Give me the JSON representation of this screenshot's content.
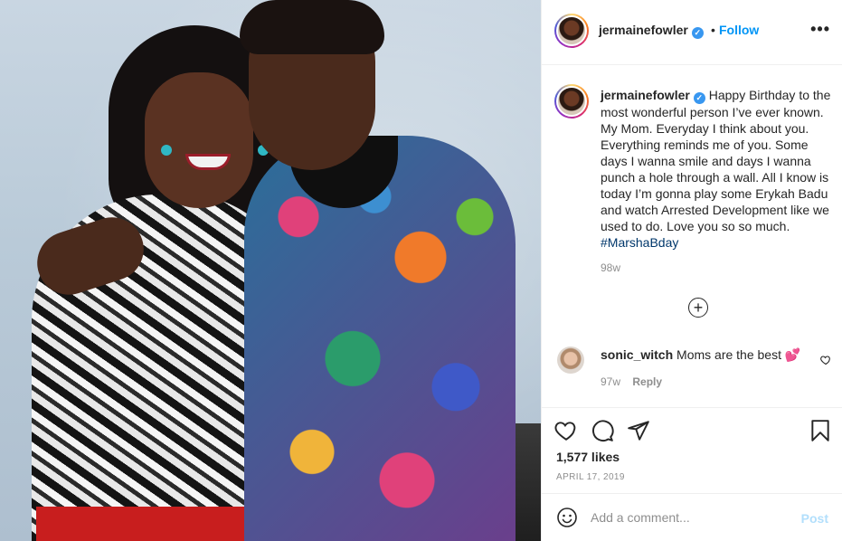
{
  "post": {
    "image_alt": "",
    "author": {
      "username": "jermainefowler",
      "verified_glyph": "✓"
    },
    "header": {
      "dot": "•",
      "follow_label": "Follow",
      "more_label": "•••"
    },
    "caption": {
      "text": "Happy Birthday to the most wonderful person I’ve ever known. My Mom. Everyday I think about you. Everything reminds me of you. Some days I wanna smile and days I wanna punch a hole through a wall. All I know is today I’m gonna play some Erykah Badu and watch Arrested Development like we used to do. Love you so so much.",
      "hashtag": "#MarshaBday",
      "time": "98w"
    },
    "load_more_icon": "plus-circle-icon",
    "load_more_glyph": "+",
    "comments": [
      {
        "username": "sonic_witch",
        "text": "Moms are the best",
        "emoji": "💕",
        "time": "97w",
        "reply_label": "Reply"
      }
    ],
    "likes": "1,577 likes",
    "date": "APRIL 17, 2019",
    "add_comment": {
      "placeholder": "Add a comment...",
      "post_label": "Post"
    },
    "colors": {
      "accent": "#0095f6",
      "post_disabled": "#b2dffc",
      "hashtag": "#00376b",
      "muted": "#8e8e8e"
    }
  }
}
